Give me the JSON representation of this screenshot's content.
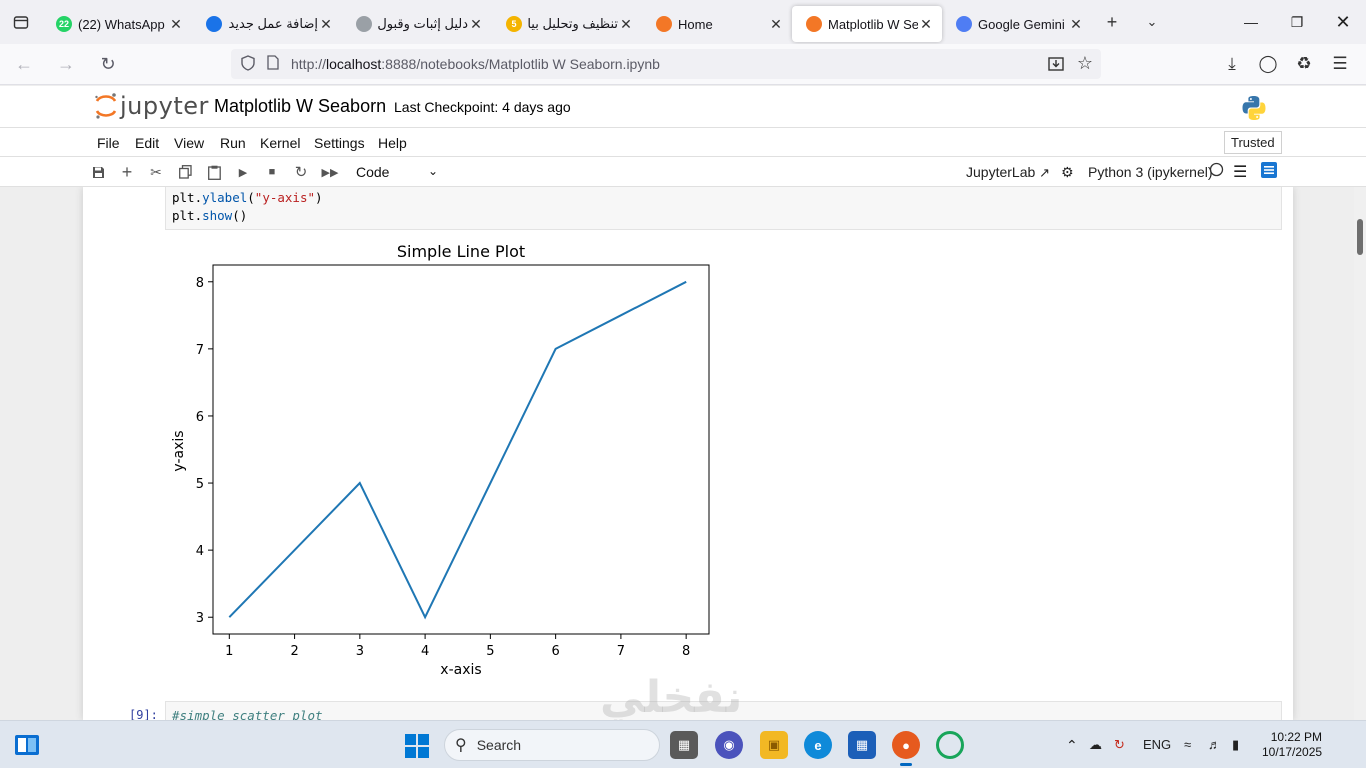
{
  "browser": {
    "tabs": [
      {
        "title": "(22) WhatsApp",
        "badge": "22",
        "color": "#25d366",
        "rtl": false,
        "active": false
      },
      {
        "title": "إضافة عمل جديد |",
        "badge": "",
        "color": "#1a73e8",
        "rtl": true,
        "active": false
      },
      {
        "title": "دليل إثبات وقبول المها",
        "badge": "",
        "color": "#9aa0a6",
        "rtl": true,
        "active": false
      },
      {
        "title": "تنظيف وتحليل بيا",
        "badge": "5",
        "color": "#f4b400",
        "rtl": true,
        "active": false
      },
      {
        "title": "Home",
        "badge": "",
        "color": "#f37726",
        "rtl": false,
        "active": false
      },
      {
        "title": "Matplotlib W Seal",
        "badge": "",
        "color": "#f37726",
        "rtl": false,
        "active": true
      },
      {
        "title": "Google Gemini",
        "badge": "",
        "color": "#4f7df3",
        "rtl": false,
        "active": false
      }
    ],
    "url_prefix": "http://",
    "url_host": "localhost",
    "url_rest": ":8888/notebooks/Matplotlib W Seaborn.ipynb"
  },
  "jupyter": {
    "logo_text": "jupyter",
    "notebook_title": "Matplotlib W Seaborn",
    "checkpoint": "Last Checkpoint: 4 days ago",
    "menu": [
      "File",
      "Edit",
      "View",
      "Run",
      "Kernel",
      "Settings",
      "Help"
    ],
    "trusted": "Trusted",
    "cell_type": "Code",
    "jupyterlab_label": "JupyterLab",
    "kernel_label": "Python 3 (ipykernel)"
  },
  "cells": {
    "cell1": {
      "line1_a": "plt.",
      "line1_fn": "ylabel",
      "line1_b": "(",
      "line1_str": "\"y-axis\"",
      "line1_c": ")",
      "line2_a": "plt.",
      "line2_fn": "show",
      "line2_b": "()"
    },
    "cell2": {
      "prompt": "[9]:",
      "comment": "#simple scatter plot"
    }
  },
  "chart_data": {
    "type": "line",
    "title": "Simple Line Plot",
    "xlabel": "x-axis",
    "ylabel": "y-axis",
    "x": [
      1,
      2,
      3,
      4,
      5,
      6,
      7,
      8
    ],
    "y": [
      3,
      4,
      5,
      3,
      5,
      7,
      7.5,
      8
    ],
    "xticks": [
      "1",
      "2",
      "3",
      "4",
      "5",
      "6",
      "7",
      "8"
    ],
    "yticks": [
      "3",
      "4",
      "5",
      "6",
      "7",
      "8"
    ],
    "xlim": [
      0.75,
      8.35
    ],
    "ylim": [
      2.75,
      8.25
    ],
    "line_color": "#1f77b4",
    "grid": false
  },
  "watermark": "نفخلي",
  "taskbar": {
    "search_placeholder": "Search",
    "lang": "ENG",
    "time": "10:22 PM",
    "date": "10/17/2025"
  }
}
